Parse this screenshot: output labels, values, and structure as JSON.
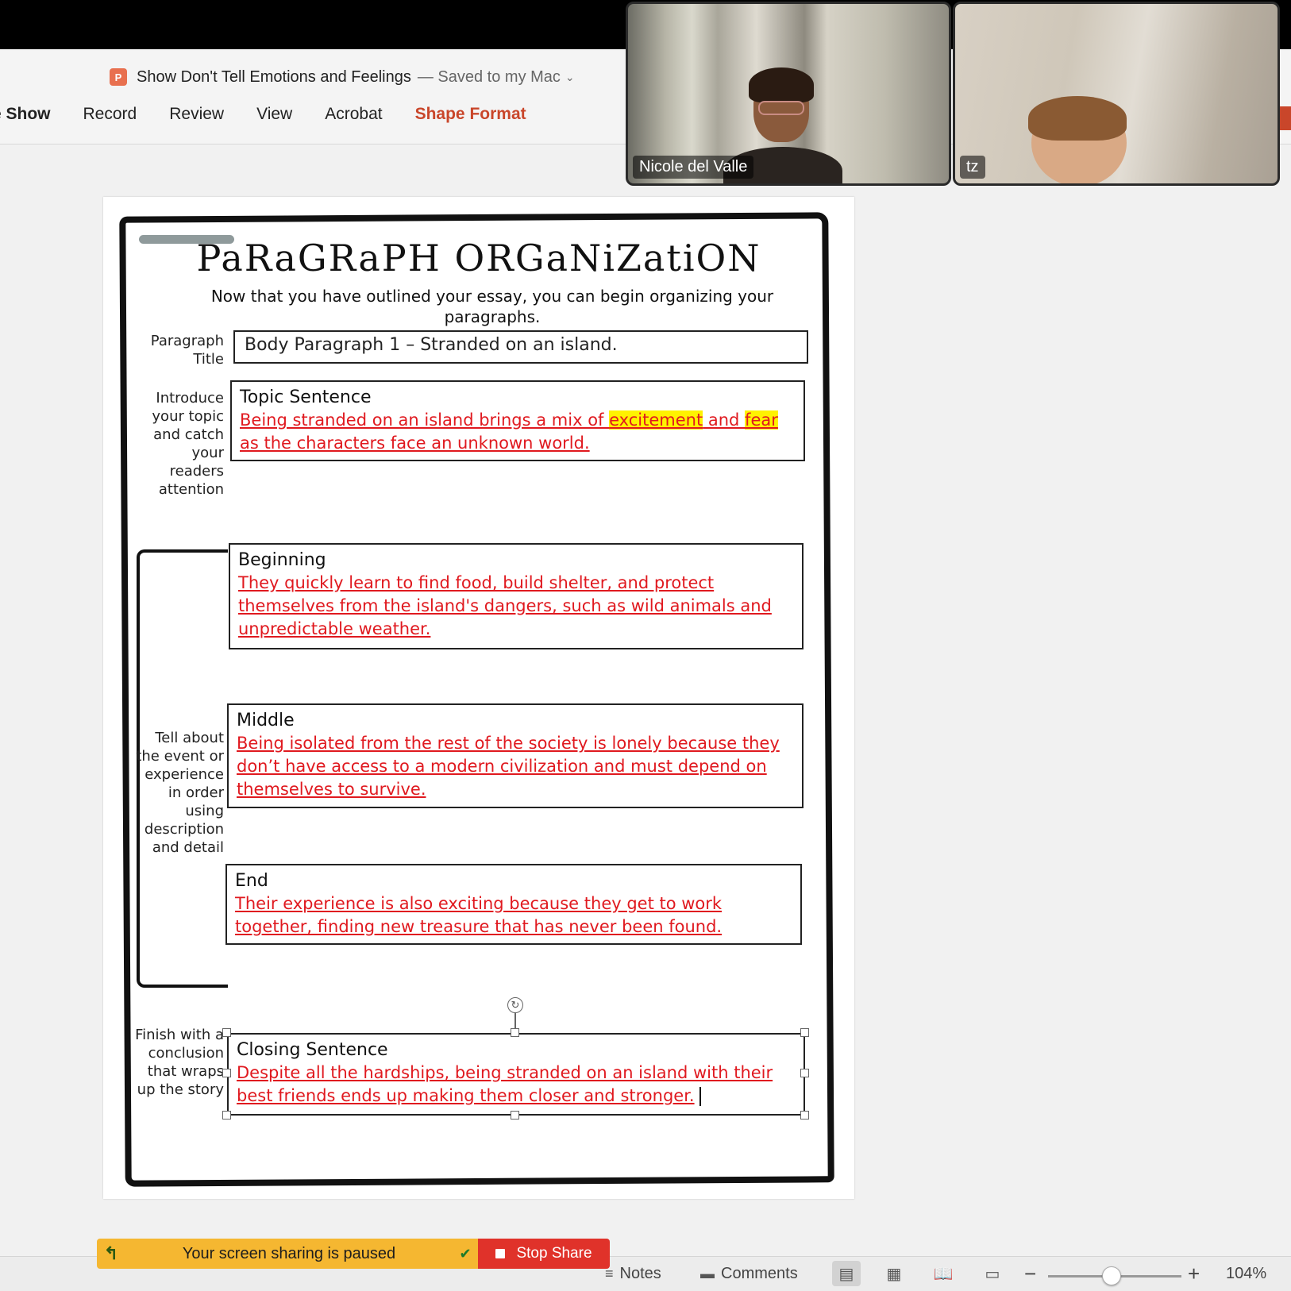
{
  "window": {
    "doc_title": "Show Don't Tell Emotions and Feelings",
    "saved_status": "— Saved to my Mac",
    "ppt_icon": "P"
  },
  "ribbon": {
    "tabs": [
      "e Show",
      "Record",
      "Review",
      "View",
      "Acrobat",
      "Shape Format"
    ],
    "active_tab": "Shape Format"
  },
  "video": {
    "participants": [
      {
        "name": "Nicole del Valle"
      },
      {
        "name": "tz"
      }
    ]
  },
  "slide": {
    "title": "PaRaGRaPH ORGaNiZatiON",
    "subtitle": "Now that you have outlined your essay, you can begin organizing your paragraphs.",
    "paragraph_title_label": "Paragraph Title",
    "paragraph_title_value": "Body Paragraph 1 – Stranded on an island.",
    "introduce_label": "Introduce your topic and catch your readers attention",
    "topic": {
      "label": "Topic Sentence",
      "text_a": "Being stranded on an island brings a mix of ",
      "hl1": "excitement",
      "text_b": " and ",
      "hl2": "fear",
      "text_c": " as the characters face an unknown world."
    },
    "tell_label": "Tell about the event or experience in order using description and detail",
    "beginning": {
      "label": "Beginning",
      "text": "They quickly learn to find food, build shelter, and protect themselves from the island's dangers, such as wild animals and unpredictable weather."
    },
    "middle": {
      "label": "Middle",
      "text": "Being isolated from the rest of the society is lonely because they don’t have access to a modern civilization and must depend on themselves to survive."
    },
    "end": {
      "label": "End",
      "text": "Their experience is also exciting because they get to work together, finding new treasure that has never been found."
    },
    "finish_label": "Finish with a conclusion that wraps up the story",
    "closing": {
      "label": "Closing Sentence",
      "text": "Despite all the hardships, being stranded on an island with their best friends ends up making them closer and stronger."
    }
  },
  "share": {
    "paused_msg": "Your screen sharing is paused",
    "stop_label": "Stop Share"
  },
  "status": {
    "notes": "Notes",
    "comments": "Comments",
    "zoom": "104%",
    "zoom_fraction": 0.5
  },
  "colors": {
    "accent": "#c9462a",
    "answer_red": "#e0191f",
    "highlight": "#fff200",
    "share_yellow": "#f5b731",
    "stop_red": "#e0322a"
  }
}
